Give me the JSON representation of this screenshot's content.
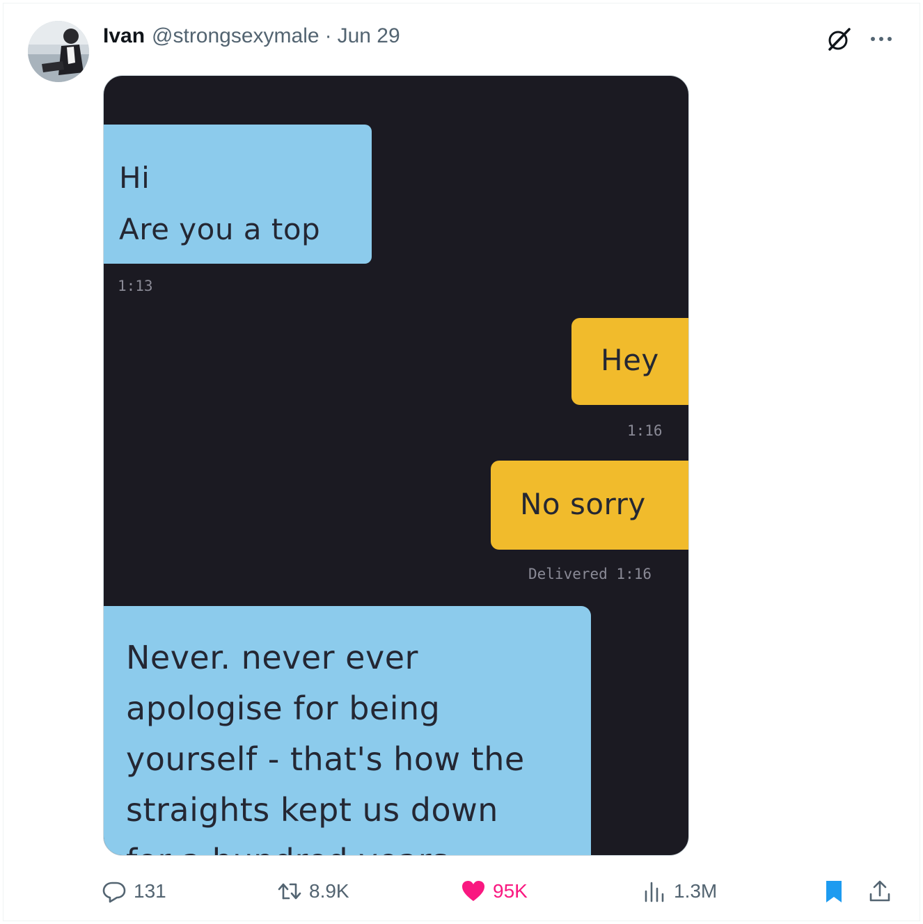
{
  "tweet": {
    "author_name": "Ivan",
    "handle": "@strongsexymale",
    "separator": "·",
    "date": "Jun 29"
  },
  "icons": {
    "avatar": "profile-photo",
    "grok": "grok-icon",
    "more": "more-dots-icon",
    "reply": "reply-bubble-icon",
    "retweet": "retweet-icon",
    "like": "heart-icon",
    "views": "analytics-bars-icon",
    "bookmark": "bookmark-icon",
    "share": "share-upload-icon"
  },
  "colors": {
    "like_active": "#f91880",
    "bookmark_active": "#1d9bf0",
    "muted_text": "#536471",
    "chat_background": "#1b1a22",
    "received_bubble": "#8ccbec",
    "sent_bubble": "#f1bb2c"
  },
  "media": {
    "messages": [
      {
        "lines": [
          "Hi",
          "Are you a top"
        ],
        "time": "1:13"
      },
      {
        "lines": [
          "Hey"
        ],
        "time": "1:16"
      },
      {
        "lines": [
          "No sorry"
        ],
        "time": "Delivered 1:16"
      },
      {
        "lines": [
          "Never. never ever",
          "apologise for being",
          "yourself - that's how the",
          "straights kept us down",
          "for a hundred years"
        ]
      }
    ]
  },
  "stats": {
    "replies": "131",
    "retweets": "8.9K",
    "likes": "95K",
    "views": "1.3M"
  }
}
